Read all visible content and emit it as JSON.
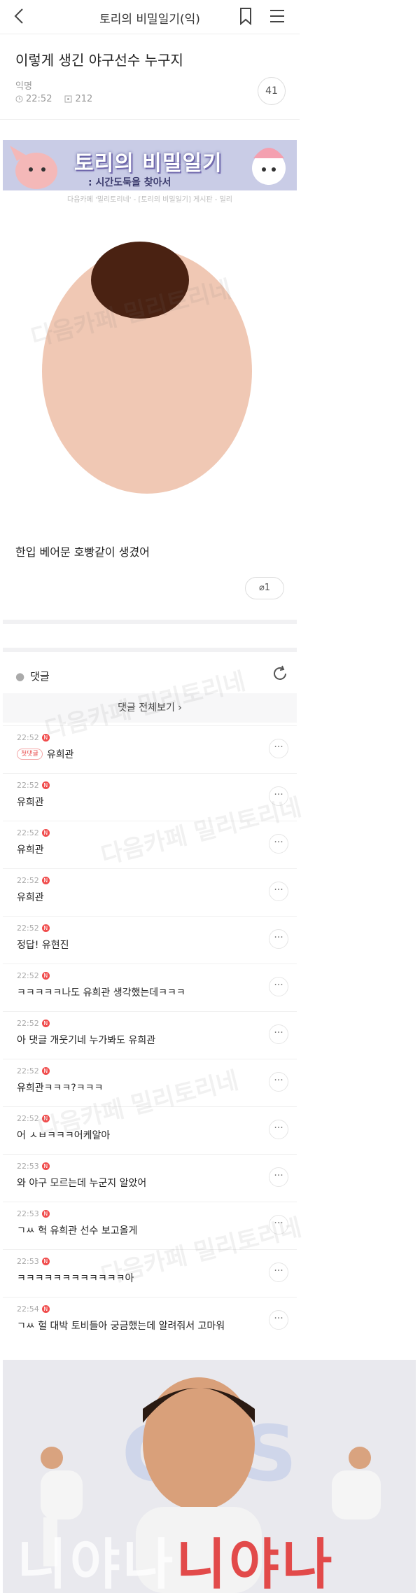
{
  "header": {
    "title": "토리의 비밀일기(익)"
  },
  "post": {
    "title": "이렇게 생긴 야구선수 누구지",
    "author": "익명",
    "time": "22:52",
    "views": "212",
    "comment_count": "41"
  },
  "banner": {
    "title": "토리의 비밀일기",
    "subtitle": ": 시간도둑을 찾아서",
    "credit": "다음카페 '밀리토리네' - [토리의 비밀일기] 게시판 - 밀리"
  },
  "body": {
    "caption": "한입 베어문 호빵같이 생겼어",
    "attachments": "1"
  },
  "comments_section": {
    "label": "댓글",
    "view_all": "댓글 전체보기",
    "items": [
      {
        "time": "22:52",
        "badge": "첫댓글",
        "text": "유희관"
      },
      {
        "time": "22:52",
        "badge": "",
        "text": "유희관"
      },
      {
        "time": "22:52",
        "badge": "",
        "text": "유희관"
      },
      {
        "time": "22:52",
        "badge": "",
        "text": "유희관"
      },
      {
        "time": "22:52",
        "badge": "",
        "text": "정답! 유현진"
      },
      {
        "time": "22:52",
        "badge": "",
        "text": "ㅋㅋㅋㅋㅋ나도 유희관 생각했는데ㅋㅋㅋ"
      },
      {
        "time": "22:52",
        "badge": "",
        "text": "아 댓글 개웃기네 누가봐도 유희관"
      },
      {
        "time": "22:52",
        "badge": "",
        "text": "유희관ㅋㅋㅋ?ㅋㅋㅋ"
      },
      {
        "time": "22:52",
        "badge": "",
        "text": "어 ㅅㅂㅋㅋㅋ어케알아"
      },
      {
        "time": "22:53",
        "badge": "",
        "text": "와 야구 모르는데 누군지 알았어"
      },
      {
        "time": "22:53",
        "badge": "",
        "text": "ㄱㅆ 헉 유희관 선수 보고올게"
      },
      {
        "time": "22:53",
        "badge": "",
        "text": "ㅋㅋㅋㅋㅋㅋㅋㅋㅋㅋㅋㅋ아"
      },
      {
        "time": "22:54",
        "badge": "",
        "text": "ㄱㅆ 헐 대박 토비들아 궁금했는데 알려줘서 고마워"
      }
    ]
  },
  "photo": {
    "logo_text": "CGS",
    "caption_left": "니야나",
    "caption_right": "니야나"
  },
  "watermark": "다음카페 밀리토리네",
  "colors": {
    "accent": "#f04c4c",
    "banner_bg": "#c9cce6",
    "face": "#f0c8b4",
    "hair": "#4a2212"
  }
}
